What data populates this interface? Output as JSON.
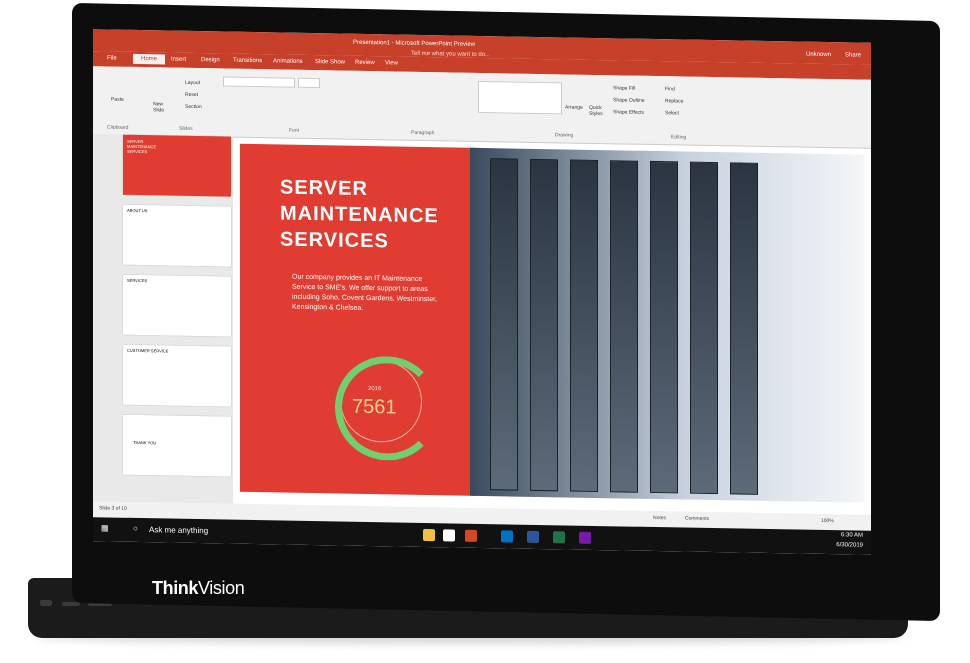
{
  "window": {
    "title": "Presentation1 - Microsoft PowerPoint Preview"
  },
  "tabs": [
    "File",
    "Home",
    "Insert",
    "Design",
    "Transitions",
    "Animations",
    "Slide Show",
    "Review",
    "View"
  ],
  "tellme": "Tell me what you want to do...",
  "account": "Unknown",
  "share": "Share",
  "ribbon": {
    "clipboard": "Clipboard",
    "paste": "Paste",
    "new_slide": "New Slide",
    "layout": "Layout",
    "reset": "Reset",
    "section": "Section",
    "slides": "Slides",
    "font": "Font",
    "paragraph": "Paragraph",
    "drawing": "Drawing",
    "arrange": "Arrange",
    "quick_styles": "Quick Styles",
    "shape_fill": "Shape Fill",
    "shape_outline": "Shape Outline",
    "shape_effects": "Shape Effects",
    "find": "Find",
    "replace": "Replace",
    "select": "Select",
    "editing": "Editing"
  },
  "thumbnails": [
    {
      "label": "SERVER MAINTENANCE SERVICES"
    },
    {
      "label": "ABOUT US"
    },
    {
      "label": "SERVICES"
    },
    {
      "label": "CUSTOMER SERVICE"
    },
    {
      "label": "THANK YOU"
    }
  ],
  "slide": {
    "title_lines": [
      "SERVER",
      "MAINTENANCE",
      "SERVICES"
    ],
    "body": "Our company provides an IT Maintenance Service to SME's. We offer support to areas including Soho, Covent Gardens, Westminster, Kensington & Chelsea.",
    "year": "2016",
    "metric": "7561"
  },
  "status": {
    "slide": "Slide 3 of 10",
    "notes": "Notes",
    "comments": "Comments",
    "zoom": "100%"
  },
  "taskbar": {
    "search": "Ask me anything",
    "time": "6:30 AM",
    "date": "6/30/2019"
  },
  "brand": {
    "think": "Think",
    "vision": "Vision"
  },
  "colors": {
    "accent": "#c6402a",
    "slide_red": "#e03c31",
    "green_ring": "#6fd06d"
  }
}
